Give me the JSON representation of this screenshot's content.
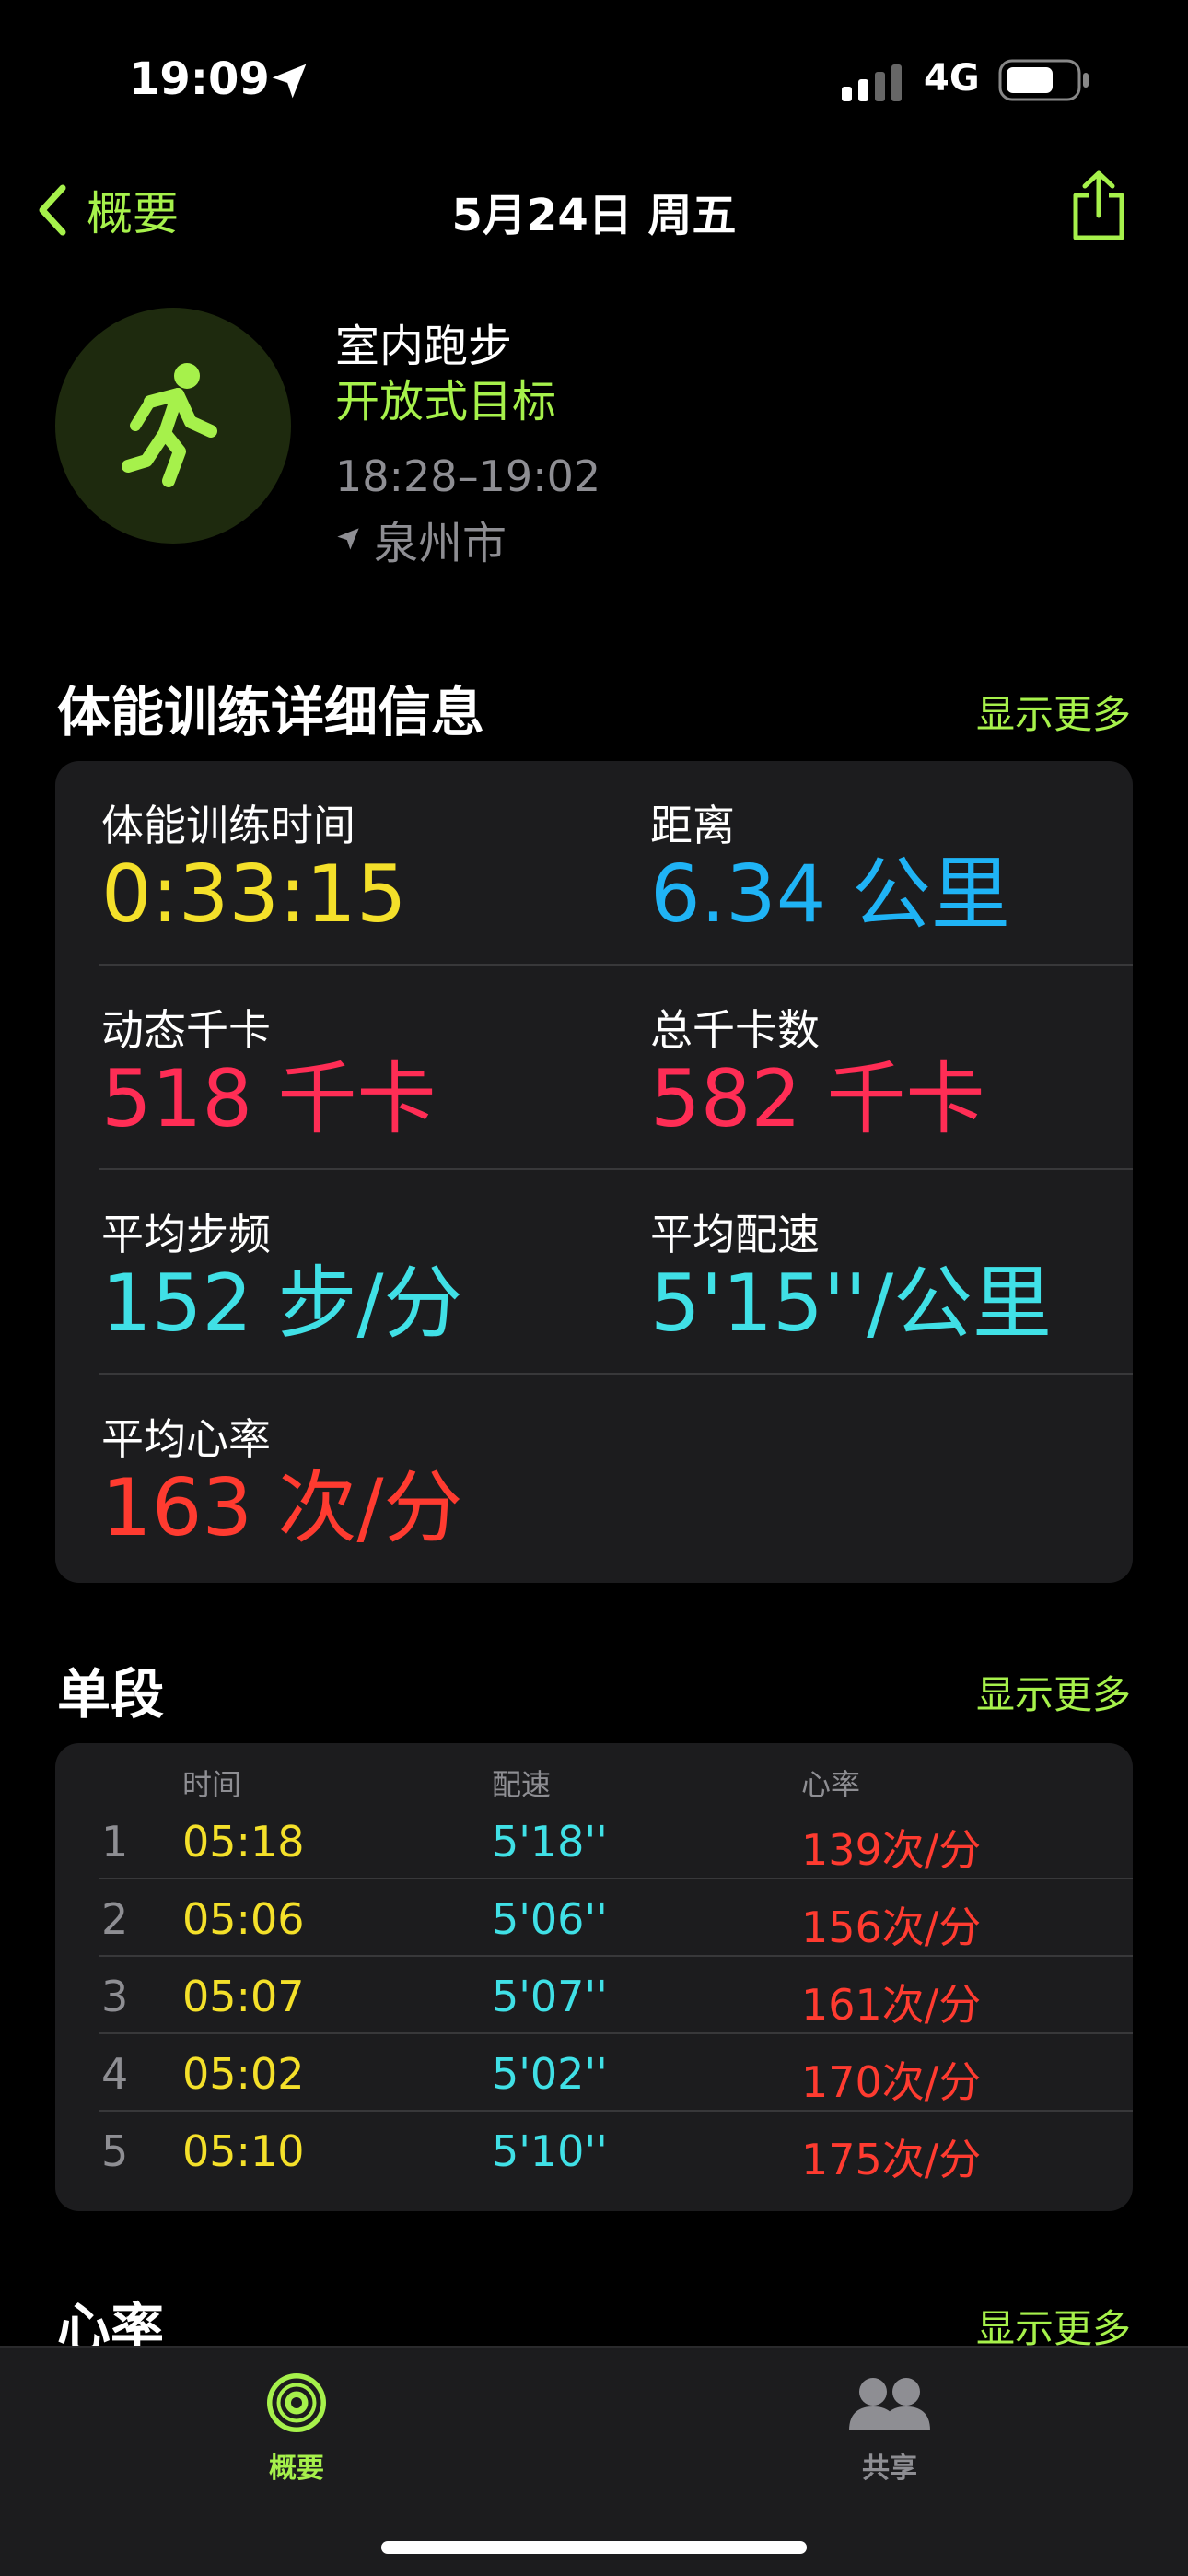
{
  "status_bar": {
    "time": "19:09",
    "network": "4G"
  },
  "nav": {
    "back_label": "概要",
    "title": "5月24日 周五"
  },
  "workout": {
    "name": "室内跑步",
    "goal": "开放式目标",
    "time_range": "18:28–19:02",
    "location": "泉州市"
  },
  "details": {
    "title": "体能训练详细信息",
    "show_more": "显示更多",
    "duration_label": "体能训练时间",
    "duration_value": "0:33:15",
    "distance_label": "距离",
    "distance_value": "6.34",
    "distance_unit": "公里",
    "active_cal_label": "动态千卡",
    "active_cal_value": "518",
    "active_cal_unit": "千卡",
    "total_cal_label": "总千卡数",
    "total_cal_value": "582",
    "total_cal_unit": "千卡",
    "cadence_label": "平均步频",
    "cadence_value": "152",
    "cadence_unit": "步",
    "cadence_per": "/分",
    "pace_label": "平均配速",
    "pace_value": "5'15''",
    "pace_per": "/公里",
    "hr_label": "平均心率",
    "hr_value": "163",
    "hr_unit": "次",
    "hr_per": "/分"
  },
  "splits": {
    "title": "单段",
    "show_more": "显示更多",
    "headers": {
      "time": "时间",
      "pace": "配速",
      "hr": "心率"
    },
    "rows": [
      {
        "num": "1",
        "time": "05:18",
        "pace": "5'18''",
        "hr": "139次/分"
      },
      {
        "num": "2",
        "time": "05:06",
        "pace": "5'06''",
        "hr": "156次/分"
      },
      {
        "num": "3",
        "time": "05:07",
        "pace": "5'07''",
        "hr": "161次/分"
      },
      {
        "num": "4",
        "time": "05:02",
        "pace": "5'02''",
        "hr": "170次/分"
      },
      {
        "num": "5",
        "time": "05:10",
        "pace": "5'10''",
        "hr": "175次/分"
      }
    ]
  },
  "heart_rate": {
    "title": "心率",
    "show_more": "显示更多"
  },
  "tabbar": {
    "summary_label": "概要",
    "sharing_label": "共享"
  },
  "colors": {
    "accent": "#a6f14b",
    "duration": "#f4e02a",
    "distance": "#1fb3f5",
    "calories": "#ff2d55",
    "cadence_pace": "#40e0e6",
    "heart_rate": "#ff3b30",
    "card_bg": "#1c1c1e"
  },
  "icons": {
    "location_status": "location-arrow-icon",
    "signal": "signal-bars-icon",
    "battery": "battery-icon",
    "back": "chevron-left-icon",
    "share": "share-icon",
    "workout": "running-figure-icon",
    "location": "location-arrow-icon",
    "summary_tab": "activity-rings-icon",
    "sharing_tab": "people-icon"
  }
}
